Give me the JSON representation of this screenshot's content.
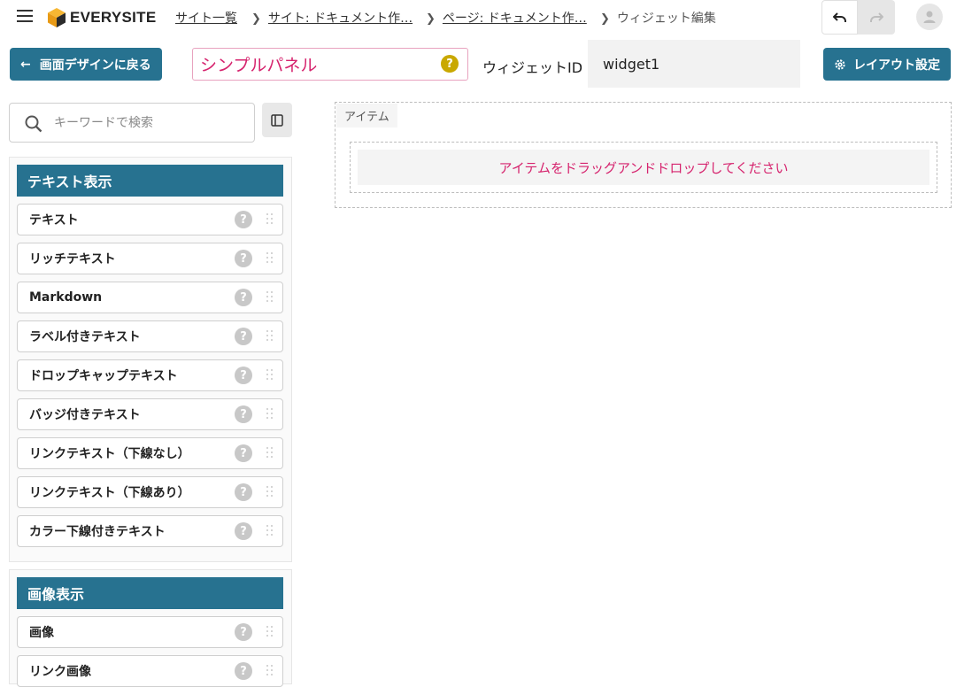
{
  "header": {
    "logo_text": "EVERYSITE",
    "breadcrumbs": [
      {
        "label": "サイト一覧"
      },
      {
        "label": "サイト: ドキュメント作…"
      },
      {
        "label": "ページ: ドキュメント作…"
      },
      {
        "label": "ウィジェット編集"
      }
    ]
  },
  "toolbar": {
    "back_label": "画面デザインに戻る",
    "widget_title": "シンプルパネル",
    "widget_id_label": "ウィジェットID",
    "widget_id_value": "widget1",
    "layout_label": "レイアウト設定"
  },
  "sidebar": {
    "search_placeholder": "キーワードで検索",
    "groups": [
      {
        "title": "テキスト表示",
        "items": [
          "テキスト",
          "リッチテキスト",
          "Markdown",
          "ラベル付きテキスト",
          "ドロップキャップテキスト",
          "バッジ付きテキスト",
          "リンクテキスト（下線なし）",
          "リンクテキスト（下線あり）",
          "カラー下線付きテキスト"
        ]
      },
      {
        "title": "画像表示",
        "items": [
          "画像",
          "リンク画像"
        ]
      }
    ]
  },
  "canvas": {
    "container_label": "アイテム",
    "drop_hint": "アイテムをドラッグアンドドロップしてください"
  },
  "colors": {
    "primary": "#277290",
    "accent_pink": "#d6246e",
    "help_yellow": "#c9a800"
  }
}
